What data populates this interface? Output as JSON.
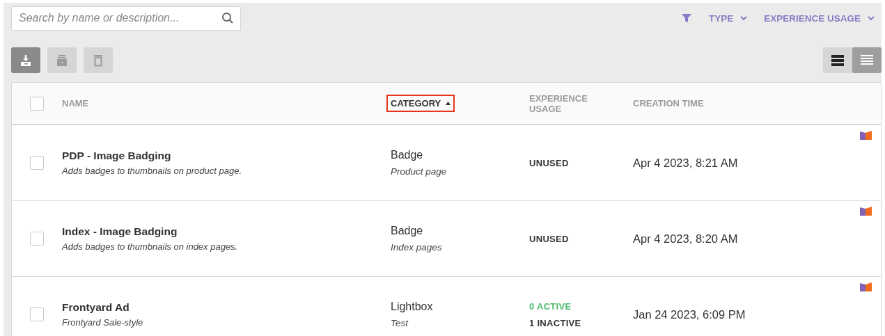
{
  "search": {
    "placeholder": "Search by name or description..."
  },
  "filters": [
    {
      "label": "TYPE"
    },
    {
      "label": "EXPERIENCE USAGE"
    }
  ],
  "toolbar": [
    {
      "kind": "download",
      "disabled": false
    },
    {
      "kind": "archive",
      "disabled": true
    },
    {
      "kind": "delete",
      "disabled": true
    }
  ],
  "view_toggle": [
    {
      "kind": "compact",
      "selected": false
    },
    {
      "kind": "list",
      "selected": true
    }
  ],
  "table": {
    "select_all": {
      "checked": false
    },
    "columns": [
      {
        "label": "NAME",
        "sorted": false
      },
      {
        "label": "CATEGORY",
        "sorted": true
      },
      {
        "label": "EXPERIENCE USAGE",
        "sorted": false
      },
      {
        "label": "CREATION TIME",
        "sorted": false
      }
    ],
    "rows": [
      {
        "checked": false,
        "name": "PDP - Image Badging",
        "description": "Adds badges to thumbnails on product page.",
        "category": "Badge",
        "subcategory": "Product page",
        "usage": [
          {
            "kind": "unused",
            "text": "UNUSED"
          }
        ],
        "created": "Apr 4 2023, 8:21 AM"
      },
      {
        "checked": false,
        "name": "Index - Image Badging",
        "description": "Adds badges to thumbnails on index pages.",
        "category": "Badge",
        "subcategory": "Index pages",
        "usage": [
          {
            "kind": "unused",
            "text": "UNUSED"
          }
        ],
        "created": "Apr 4 2023, 8:20 AM"
      },
      {
        "checked": false,
        "name": "Frontyard Ad",
        "description": "Frontyard Sale-style",
        "category": "Lightbox",
        "subcategory": "Test",
        "usage": [
          {
            "kind": "active",
            "text": "0 ACTIVE"
          },
          {
            "kind": "inactive",
            "text": "1 INACTIVE"
          }
        ],
        "created": "Jan 24 2023, 6:09 PM"
      }
    ]
  }
}
